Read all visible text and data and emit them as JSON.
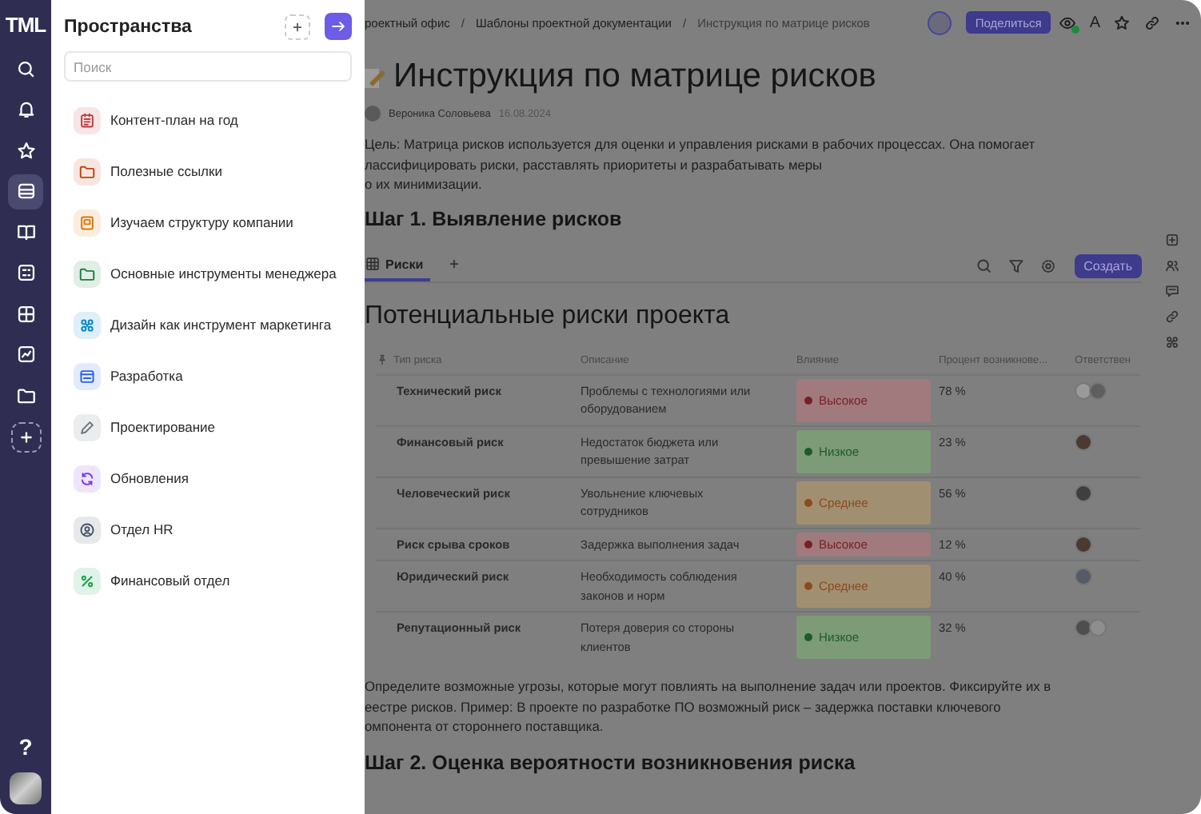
{
  "rail": {
    "logo": "TML",
    "items": [
      {
        "kind": "search",
        "selected": false
      },
      {
        "kind": "bell",
        "selected": false
      },
      {
        "kind": "star",
        "selected": false
      },
      {
        "kind": "stack",
        "selected": true
      },
      {
        "kind": "book",
        "selected": false
      },
      {
        "kind": "app",
        "selected": false
      },
      {
        "kind": "grid",
        "selected": false
      },
      {
        "kind": "chart",
        "selected": false
      },
      {
        "kind": "folder",
        "selected": false
      },
      {
        "kind": "add",
        "selected": false
      }
    ],
    "help": "?"
  },
  "spaces_panel": {
    "title": "Пространства",
    "search": {
      "placeholder": "Поиск"
    },
    "items": [
      {
        "label": "Контент-план на год",
        "kind": "calendar",
        "color": "#c0393b"
      },
      {
        "label": "Полезные ссылки",
        "kind": "folder",
        "color": "#c2410c"
      },
      {
        "label": "Изучаем структуру компании",
        "kind": "board",
        "color": "#d97706"
      },
      {
        "label": "Основные инструменты менеджера",
        "kind": "folder",
        "color": "#15803d"
      },
      {
        "label": "Дизайн как инструмент маркетинга",
        "kind": "design",
        "color": "#0284c7"
      },
      {
        "label": "Разработка",
        "kind": "window",
        "color": "#2563eb"
      },
      {
        "label": "Проектирование",
        "kind": "pencil",
        "color": "#6b7280"
      },
      {
        "label": "Обновления",
        "kind": "refresh",
        "color": "#7c3aed"
      },
      {
        "label": "Отдел HR",
        "kind": "user",
        "color": "#475569"
      },
      {
        "label": "Финансовый отдел",
        "kind": "percent",
        "color": "#16a34a"
      }
    ]
  },
  "document": {
    "breadcrumbs": [
      {
        "label": "роектный офис",
        "current": false
      },
      {
        "separator": "/",
        "label": "Шаблоны проектной документации",
        "current": false
      },
      {
        "separator": "/",
        "label": "Инструкция по матрице рисков",
        "current": true
      }
    ],
    "share": "Поделиться",
    "font_button": "A",
    "title": "Инструкция по матрице рисков",
    "author": "Вероника Соловьева",
    "date": "16.08.2024",
    "intro": [
      "Цель: Матрица рисков используется для оценки и управления рисками в рабочих процессах. Она помогает",
      "лассифицировать риски, расставлять приоритеты и разрабатывать меры",
      "о их минимизации."
    ],
    "heading_1": "Шаг 1. Выявление рисков",
    "tabs": [
      {
        "label": "Риски",
        "selected": true
      }
    ],
    "create": "Создать",
    "table": {
      "title": "Потенциальные риски проекта",
      "columns": [
        "Тип риска",
        "Описание",
        "Влияние",
        "Процент возникнове...",
        "Ответствен"
      ],
      "rows": [
        {
          "type": "Технический риск",
          "description": "Проблемы с технологиями или оборудованием",
          "impact": {
            "label": "Высокое",
            "kind": "high",
            "color": "#7a1f24"
          },
          "percent": "78 %",
          "avatars": [
            {
              "color": "#9a9a9a"
            },
            {
              "color": "#5e5e5e"
            }
          ]
        },
        {
          "type": "Финансовый риск",
          "description": "Недостаток бюджета или превышение затрат",
          "impact": {
            "label": "Низкое",
            "kind": "low",
            "color": "#1f5a2a"
          },
          "percent": "23 %",
          "avatars": [
            {
              "color": "#4a3a30"
            }
          ]
        },
        {
          "type": "Человеческий риск",
          "description": "Увольнение ключевых сотрудников",
          "impact": {
            "label": "Среднее",
            "kind": "medium",
            "color": "#8a4a1f"
          },
          "percent": "56 %",
          "avatars": [
            {
              "color": "#3f3f3f"
            }
          ]
        },
        {
          "type": "Риск срыва сроков",
          "description": "Задержка выполнения задач",
          "impact": {
            "label": "Высокое",
            "kind": "high",
            "color": "#7a1f24"
          },
          "percent": "12 %",
          "avatars": [
            {
              "color": "#4a3a30"
            }
          ]
        },
        {
          "type": "Юридический риск",
          "description": "Необходимость соблюдения законов и норм",
          "impact": {
            "label": "Среднее",
            "kind": "medium",
            "color": "#8a4a1f"
          },
          "percent": "40 %",
          "avatars": [
            {
              "color": "#555a66"
            }
          ]
        },
        {
          "type": "Репутационный риск",
          "description": "Потеря доверия со стороны клиентов",
          "impact": {
            "label": "Низкое",
            "kind": "low",
            "color": "#1f5a2a"
          },
          "percent": "32 %",
          "avatars": [
            {
              "color": "#4e4e4e"
            },
            {
              "color": "#8e8e8e"
            }
          ]
        }
      ]
    },
    "outro": [
      "Определите возможные угрозы, которые могут повлиять на выполнение задач или проектов. Фиксируйте их в",
      "еестре рисков. Пример: В проекте по разработке ПО возможный риск – задержка поставки ключевого",
      "омпонента от стороннего поставщика."
    ],
    "heading_2": "Шаг 2. Оценка вероятности возникновения риска"
  }
}
